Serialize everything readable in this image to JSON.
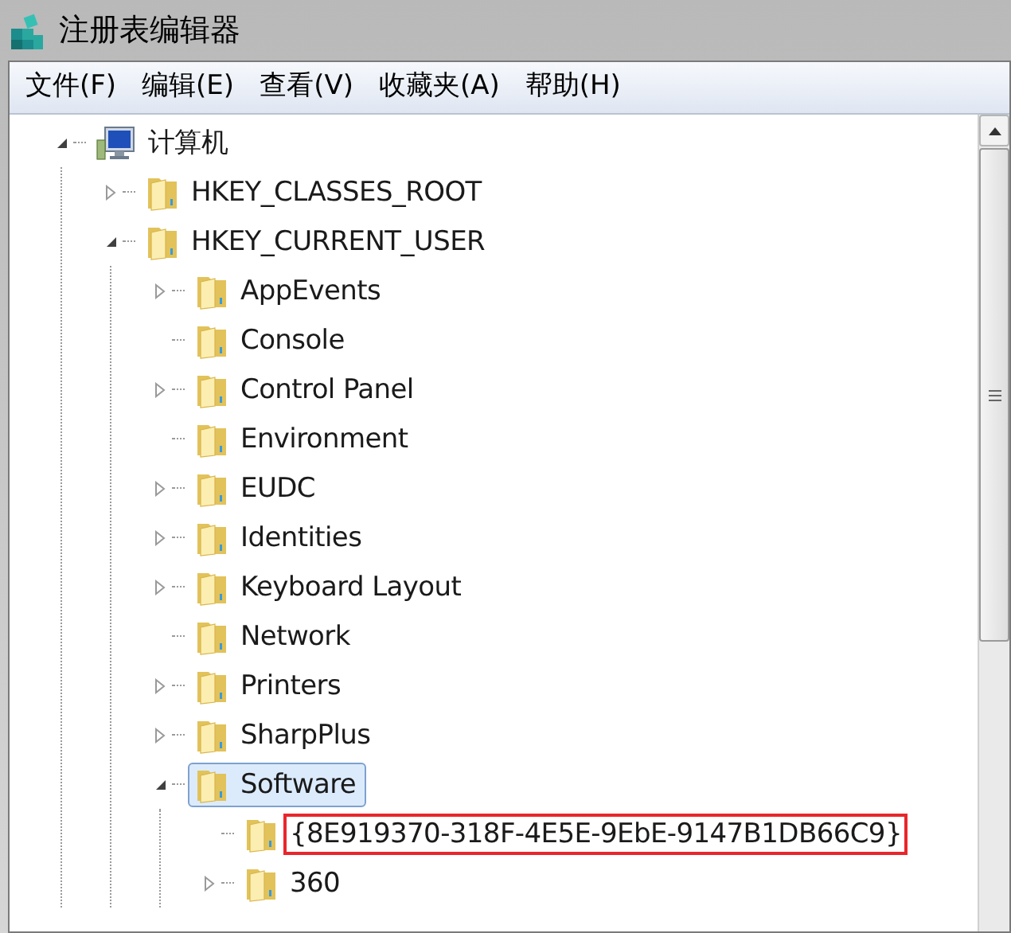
{
  "window": {
    "title": "注册表编辑器"
  },
  "menu": [
    "文件(F)",
    "编辑(E)",
    "查看(V)",
    "收藏夹(A)",
    "帮助(H)"
  ],
  "tree": [
    {
      "label": "计算机",
      "kind": "computer",
      "expandable": true,
      "expanded": true,
      "selected": false,
      "highlighted": false,
      "children": [
        {
          "label": "HKEY_CLASSES_ROOT",
          "kind": "folder",
          "expandable": true,
          "expanded": false,
          "selected": false,
          "highlighted": false
        },
        {
          "label": "HKEY_CURRENT_USER",
          "kind": "folder",
          "expandable": true,
          "expanded": true,
          "selected": false,
          "highlighted": false,
          "children": [
            {
              "label": "AppEvents",
              "kind": "folder",
              "expandable": true,
              "expanded": false,
              "selected": false,
              "highlighted": false
            },
            {
              "label": "Console",
              "kind": "folder",
              "expandable": false,
              "expanded": false,
              "selected": false,
              "highlighted": false
            },
            {
              "label": "Control Panel",
              "kind": "folder",
              "expandable": true,
              "expanded": false,
              "selected": false,
              "highlighted": false
            },
            {
              "label": "Environment",
              "kind": "folder",
              "expandable": false,
              "expanded": false,
              "selected": false,
              "highlighted": false
            },
            {
              "label": "EUDC",
              "kind": "folder",
              "expandable": true,
              "expanded": false,
              "selected": false,
              "highlighted": false
            },
            {
              "label": "Identities",
              "kind": "folder",
              "expandable": true,
              "expanded": false,
              "selected": false,
              "highlighted": false
            },
            {
              "label": "Keyboard Layout",
              "kind": "folder",
              "expandable": true,
              "expanded": false,
              "selected": false,
              "highlighted": false
            },
            {
              "label": "Network",
              "kind": "folder",
              "expandable": false,
              "expanded": false,
              "selected": false,
              "highlighted": false
            },
            {
              "label": "Printers",
              "kind": "folder",
              "expandable": true,
              "expanded": false,
              "selected": false,
              "highlighted": false
            },
            {
              "label": "SharpPlus",
              "kind": "folder",
              "expandable": true,
              "expanded": false,
              "selected": false,
              "highlighted": false
            },
            {
              "label": "Software",
              "kind": "folder",
              "expandable": true,
              "expanded": true,
              "selected": true,
              "highlighted": false,
              "children": [
                {
                  "label": "{8E919370-318F-4E5E-9EbE-9147B1DB66C9}",
                  "kind": "folder",
                  "expandable": false,
                  "expanded": false,
                  "selected": false,
                  "highlighted": true
                },
                {
                  "label": "360",
                  "kind": "folder",
                  "expandable": true,
                  "expanded": false,
                  "selected": false,
                  "highlighted": false
                }
              ]
            }
          ]
        }
      ]
    }
  ]
}
